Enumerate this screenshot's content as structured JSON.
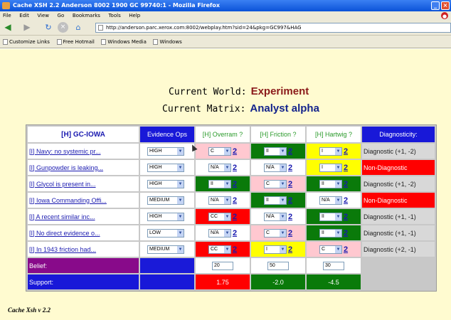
{
  "window": {
    "title": "Cache XSH 2.2 Anderson 8002 1900 GC 99740:1 - Mozilla Firefox"
  },
  "menu": [
    "File",
    "Edit",
    "View",
    "Go",
    "Bookmarks",
    "Tools",
    "Help"
  ],
  "address": {
    "url": "http://anderson.parc.xerox.com:8002/webplay.htm?sid=24&pkg=GC997&HAG"
  },
  "bookmarks": [
    "Customize Links",
    "Free Hotmail",
    "Windows Media",
    "Windows"
  ],
  "header": {
    "world_label": "Current World:",
    "world_value": "Experiment",
    "matrix_label": "Current Matrix:",
    "matrix_value": "Analyst alpha"
  },
  "table": {
    "headers": {
      "hypothesis": "[H] GC-IOWA",
      "evidence_ops": "Evidence Ops",
      "h1": "[H] Overram ?",
      "h2": "[H] Friction ?",
      "h3": "[H] Hartwig ?",
      "diagnosticity": "Diagnosticity:"
    },
    "rows": [
      {
        "ev": "[I] Navy: no systemic pr...",
        "weight": "HIGH",
        "h": [
          {
            "v": "C",
            "n": "2"
          },
          {
            "v": "II",
            "n": "2"
          },
          {
            "v": "I",
            "n": "2"
          }
        ],
        "diag": "Diagnostic (+1, -2)"
      },
      {
        "ev": "[I] Gunpowder is leaking...",
        "weight": "HIGH",
        "h": [
          {
            "v": "N/A",
            "n": "2"
          },
          {
            "v": "N/A",
            "n": "2"
          },
          {
            "v": "I",
            "n": "2"
          }
        ],
        "diag": "Non-Diagnostic"
      },
      {
        "ev": "[I] Glycol is present in...",
        "weight": "HIGH",
        "h": [
          {
            "v": "II",
            "n": "2"
          },
          {
            "v": "C",
            "n": "2"
          },
          {
            "v": "II",
            "n": "2"
          }
        ],
        "diag": "Diagnostic (+1, -2)"
      },
      {
        "ev": "[I] Iowa Commanding Offi...",
        "weight": "MEDIUM",
        "h": [
          {
            "v": "N/A",
            "n": "2"
          },
          {
            "v": "II",
            "n": "2"
          },
          {
            "v": "N/A",
            "n": "2"
          }
        ],
        "diag": "Non-Diagnostic"
      },
      {
        "ev": "[I] A recent similar inc...",
        "weight": "HIGH",
        "h": [
          {
            "v": "CC",
            "n": "2"
          },
          {
            "v": "N/A",
            "n": "2"
          },
          {
            "v": "II",
            "n": "2"
          }
        ],
        "diag": "Diagnostic (+1, -1)"
      },
      {
        "ev": "[I] No direct evidence o...",
        "weight": "LOW",
        "h": [
          {
            "v": "N/A",
            "n": "2"
          },
          {
            "v": "C",
            "n": "2"
          },
          {
            "v": "II",
            "n": "2"
          }
        ],
        "diag": "Diagnostic (+1, -1)"
      },
      {
        "ev": "[I] In 1943 friction had...",
        "weight": "MEDIUM",
        "h": [
          {
            "v": "CC",
            "n": "2"
          },
          {
            "v": "I",
            "n": "2"
          },
          {
            "v": "C",
            "n": "2"
          }
        ],
        "diag": "Diagnostic (+2, -1)"
      }
    ],
    "belief": {
      "label": "Belief:",
      "values": [
        "20",
        "50",
        "30"
      ]
    },
    "support": {
      "label": "Support:",
      "values": [
        "1.75",
        "-2.0",
        "-4.5"
      ]
    }
  },
  "footer": {
    "text": "Cache Xsh v 2.2"
  },
  "colors": {
    "pink": "#ffc8d0",
    "green": "#0a7a0a",
    "yellow": "#ffff00",
    "red": "#ff0000",
    "blue": "#1818d8",
    "purple": "#880a8a"
  }
}
